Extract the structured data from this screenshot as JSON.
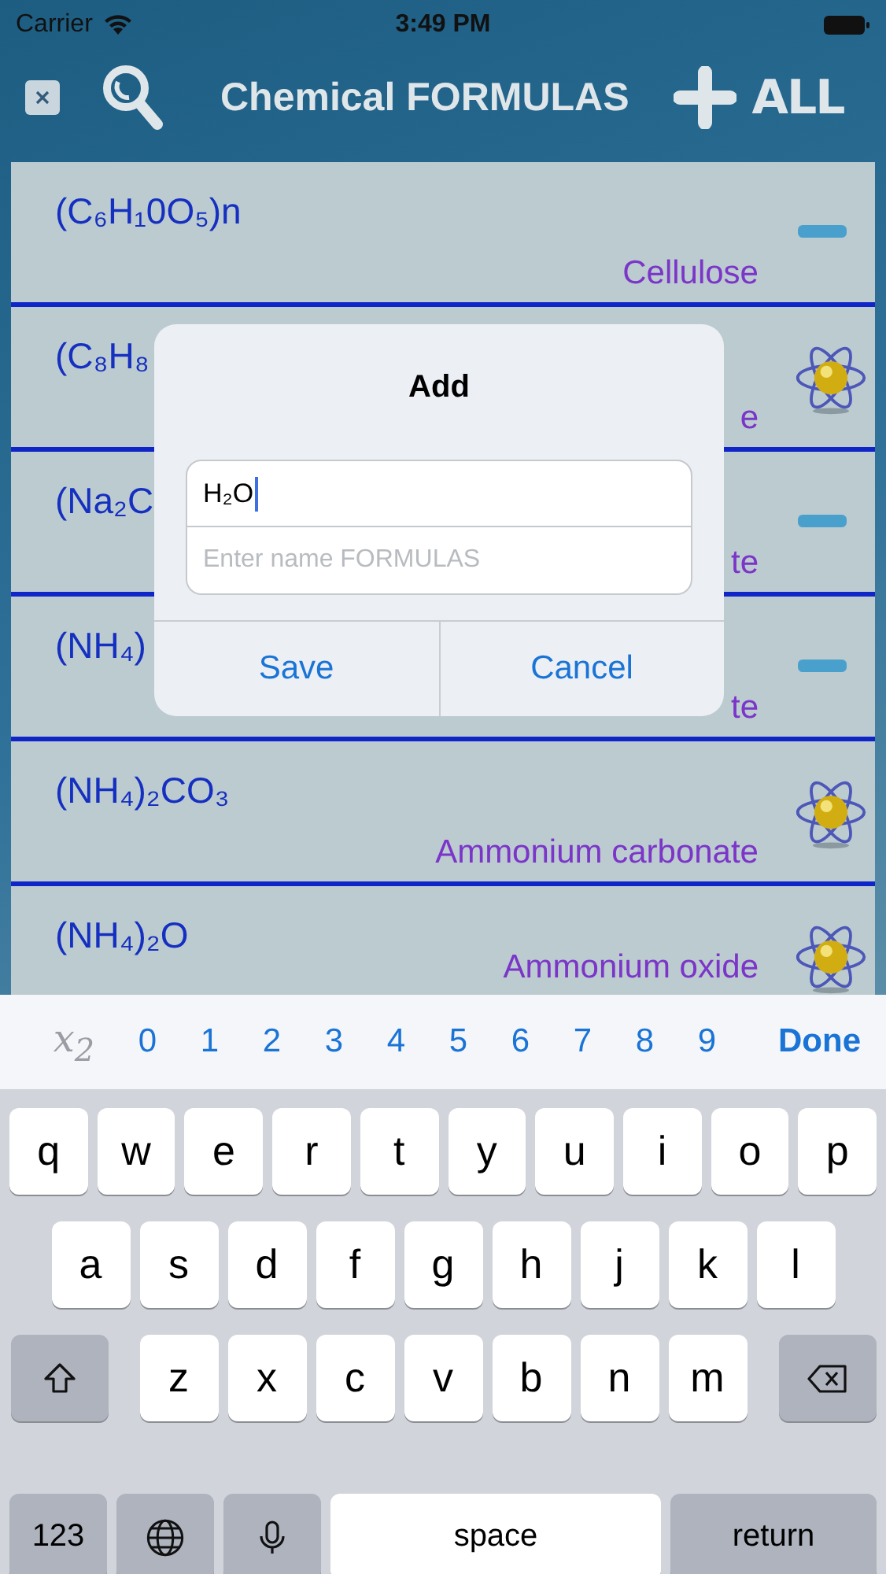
{
  "status_bar": {
    "carrier": "Carrier",
    "time": "3:49 PM"
  },
  "nav": {
    "title": "Chemical FORMULAS",
    "all_label": "ALL"
  },
  "rows": [
    {
      "formula": "(C₆H₁0O₅)n",
      "name": "Cellulose",
      "kind": "minus"
    },
    {
      "formula": "(C₈H₈",
      "name": "e",
      "kind": "atom"
    },
    {
      "formula": "(Na₂C",
      "name": "te",
      "kind": "minus"
    },
    {
      "formula": "(NH₄)",
      "name": "te",
      "kind": "minus"
    },
    {
      "formula": "(NH₄)₂CO₃",
      "name": "Ammonium carbonate",
      "kind": "atom"
    },
    {
      "formula": "(NH₄)₂O",
      "name": "Ammonium oxide",
      "kind": "atom"
    }
  ],
  "dialog": {
    "title": "Add",
    "formula_value": "H₂O",
    "name_placeholder": "Enter name FORMULAS",
    "buttons": [
      "Save",
      "Cancel"
    ]
  },
  "toolbar": {
    "subscript_key": "x$_{2}$",
    "digits": [
      "0",
      "1",
      "2",
      "3",
      "4",
      "5",
      "6",
      "7",
      "8",
      "9"
    ],
    "done": "Done"
  },
  "keyboard": [
    [
      {
        "kind": "letter",
        "label": "q"
      },
      {
        "kind": "letter",
        "label": "w"
      },
      {
        "kind": "letter",
        "label": "e"
      },
      {
        "kind": "letter",
        "label": "r"
      },
      {
        "kind": "letter",
        "label": "t"
      },
      {
        "kind": "letter",
        "label": "y"
      },
      {
        "kind": "letter",
        "label": "u"
      },
      {
        "kind": "letter",
        "label": "i"
      },
      {
        "kind": "letter",
        "label": "o"
      },
      {
        "kind": "letter",
        "label": "p"
      }
    ],
    [
      {
        "kind": "letter",
        "label": "a"
      },
      {
        "kind": "letter",
        "label": "s"
      },
      {
        "kind": "letter",
        "label": "d"
      },
      {
        "kind": "letter",
        "label": "f"
      },
      {
        "kind": "letter",
        "label": "g"
      },
      {
        "kind": "letter",
        "label": "h"
      },
      {
        "kind": "letter",
        "label": "j"
      },
      {
        "kind": "letter",
        "label": "k"
      },
      {
        "kind": "letter",
        "label": "l"
      }
    ],
    [
      {
        "kind": "shift"
      },
      {
        "kind": "letter",
        "label": "z"
      },
      {
        "kind": "letter",
        "label": "x"
      },
      {
        "kind": "letter",
        "label": "c"
      },
      {
        "kind": "letter",
        "label": "v"
      },
      {
        "kind": "letter",
        "label": "b"
      },
      {
        "kind": "letter",
        "label": "n"
      },
      {
        "kind": "letter",
        "label": "m"
      },
      {
        "kind": "backspace"
      }
    ],
    [
      {
        "kind": "mode",
        "label": "123"
      },
      {
        "kind": "globe"
      },
      {
        "kind": "mic"
      },
      {
        "kind": "space",
        "label": "space"
      },
      {
        "kind": "return",
        "label": "return"
      }
    ]
  ]
}
